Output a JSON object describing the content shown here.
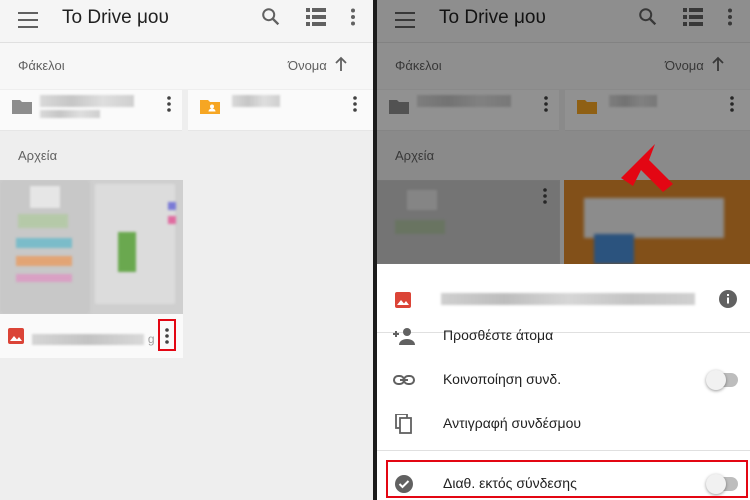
{
  "app": {
    "title": "To Drive μου",
    "folders_label": "Φάκελοι",
    "sort_label": "Όνομα",
    "files_label": "Αρχεία"
  },
  "sheet": {
    "items": [
      {
        "icon": "add-person-icon",
        "label": "Προσθέστε άτομα"
      },
      {
        "icon": "link-icon",
        "label": "Κοινοποίηση συνδ.",
        "toggle": "off"
      },
      {
        "icon": "copy-icon",
        "label": "Αντιγραφή συνδέσμου"
      },
      {
        "icon": "offline-check-icon",
        "label": "Διαθ. εκτός σύνδεσης",
        "toggle": "off"
      }
    ]
  },
  "colors": {
    "highlight": "#e30613",
    "folder_personal": "#f6a623",
    "image_icon": "#db4437",
    "text": "#212121"
  }
}
